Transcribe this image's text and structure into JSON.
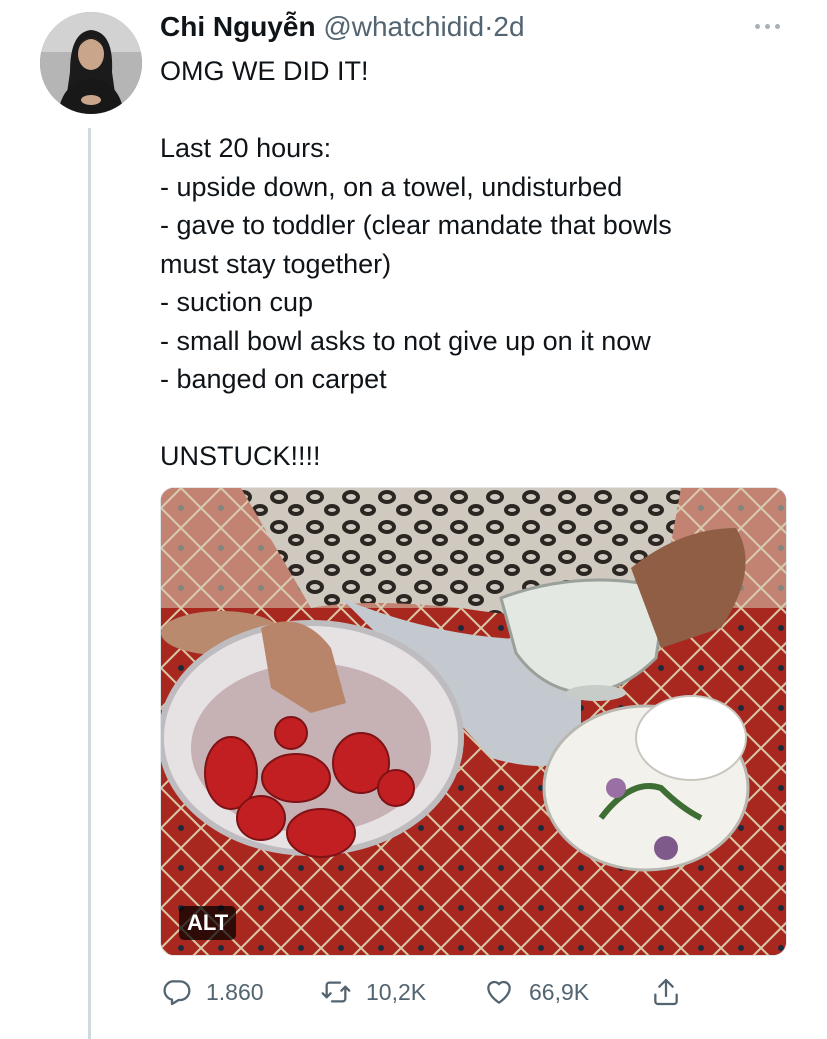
{
  "author": {
    "name": "Chi Nguyễn",
    "handle": "@whatchidid",
    "separator": "·",
    "time": "2d",
    "avatar_icon": "profile-photo"
  },
  "tweet": {
    "lines": [
      "OMG WE DID IT!",
      "",
      "Last 20 hours:",
      "- upside down, on a towel, undisturbed",
      "- gave to toddler (clear mandate that bowls",
      "must stay together)",
      "- suction cup",
      "- small bowl asks to not give up on it now",
      "- banged on carpet",
      "",
      "UNSTUCK!!!!"
    ]
  },
  "media": {
    "alt_badge": "ALT"
  },
  "actions": {
    "reply_count": "1.860",
    "retweet_count": "10,2K",
    "like_count": "66,9K",
    "icons": [
      "reply-icon",
      "retweet-icon",
      "like-icon",
      "share-icon"
    ]
  },
  "colors": {
    "text": "#0f1419",
    "secondary": "#536471",
    "thread_line": "#cfd9de"
  }
}
